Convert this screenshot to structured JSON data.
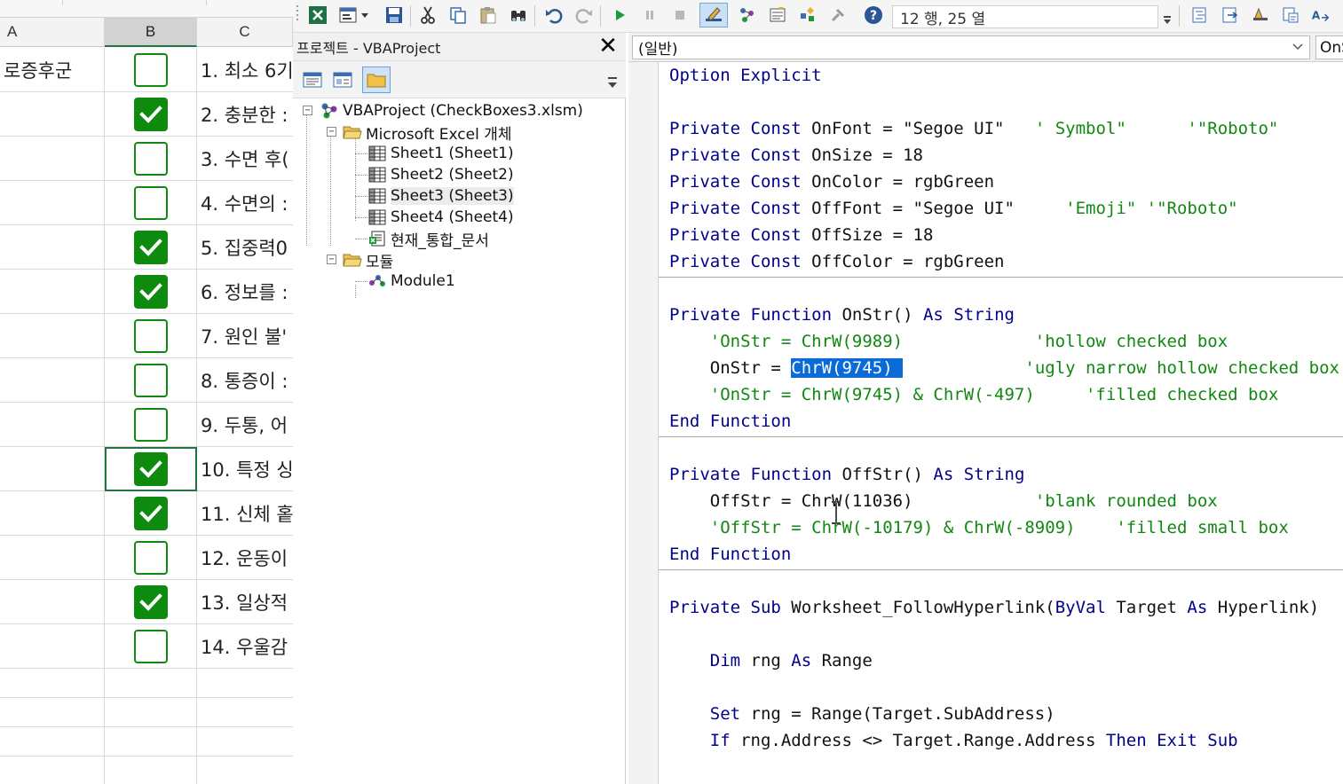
{
  "sheet": {
    "columns": [
      "A",
      "B",
      "C"
    ],
    "rows": [
      {
        "a": "로증후군",
        "checked": false,
        "c": "1. 최소 6기"
      },
      {
        "a": "",
        "checked": true,
        "c": "2. 충분한 :"
      },
      {
        "a": "",
        "checked": false,
        "c": "3. 수면 후("
      },
      {
        "a": "",
        "checked": false,
        "c": "4. 수면의 :"
      },
      {
        "a": "",
        "checked": true,
        "c": "5. 집중력0"
      },
      {
        "a": "",
        "checked": true,
        "c": "6. 정보를 :"
      },
      {
        "a": "",
        "checked": false,
        "c": "7. 원인 불'"
      },
      {
        "a": "",
        "checked": false,
        "c": "8. 통증이 :"
      },
      {
        "a": "",
        "checked": false,
        "c": "9. 두통, 어"
      },
      {
        "a": "",
        "checked": true,
        "c": "10. 특정 싱"
      },
      {
        "a": "",
        "checked": true,
        "c": "11. 신체 홑"
      },
      {
        "a": "",
        "checked": false,
        "c": "12. 운동이"
      },
      {
        "a": "",
        "checked": true,
        "c": "13. 일상적"
      },
      {
        "a": "",
        "checked": false,
        "c": "14. 우울감"
      }
    ]
  },
  "toolbar": {
    "position_status": "12 행, 25 열"
  },
  "project": {
    "title": "프로젝트 - VBAProject",
    "close_label": "✕",
    "root": "VBAProject (CheckBoxes3.xlsm)",
    "folder_objects": "Microsoft Excel 개체",
    "sheets": [
      "Sheet1 (Sheet1)",
      "Sheet2 (Sheet2)",
      "Sheet3 (Sheet3)",
      "Sheet4 (Sheet4)"
    ],
    "workbook": "현재_통합_문서",
    "folder_modules": "모듈",
    "module": "Module1"
  },
  "code": {
    "object_combo": "(일반)",
    "procedure_combo": "OnStr",
    "lines": {
      "l1": "Option Explicit",
      "c1_kw": "Private Const ",
      "c1_rest": "OnFont = \"Segoe UI\"   ",
      "c1_cm": "' Symbol\"      '\"Roboto\"",
      "c2_kw": "Private Const ",
      "c2_rest": "OnSize = 18",
      "c3_kw": "Private Const ",
      "c3_rest": "OnColor = rgbGreen",
      "c4_kw": "Private Const ",
      "c4_rest": "OffFont = \"Segoe UI\"     ",
      "c4_cm": "'Emoji\" '\"Roboto\"",
      "c5_kw": "Private Const ",
      "c5_rest": "OffSize = 18",
      "c6_kw": "Private Const ",
      "c6_rest": "OffColor = rgbGreen",
      "f1_kw": "Private Function ",
      "f1_name": "OnStr() ",
      "f1_as": "As ",
      "f1_type": "String",
      "f1_l1_cm": "    'OnStr = ChrW(9989)             'hollow checked box",
      "f1_l2_pre": "    OnStr = ",
      "f1_l2_hl": "ChrW(9745) ",
      "f1_l2_cm": "            'ugly narrow hollow checked box",
      "f1_l3_cm": "    'OnStr = ChrW(9745) & ChrW(-497)     'filled checked box",
      "f1_end": "End Function",
      "f2_kw": "Private Function ",
      "f2_name": "OffStr() ",
      "f2_as": "As ",
      "f2_type": "String",
      "f2_l1_pre": "    OffStr = ChrW(11036)            ",
      "f2_l1_cm": "'blank rounded box",
      "f2_l2_cm": "    'OffStr = ChrW(-10179) & ChrW(-8909)    'filled small box",
      "f2_end": "End Function",
      "s1_kw": "Private Sub ",
      "s1_name": "Worksheet_FollowHyperlink(",
      "s1_byval": "ByVal ",
      "s1_mid": "Target ",
      "s1_as": "As ",
      "s1_type": "Hyperlink)",
      "s1_l1_dim": "    Dim ",
      "s1_l1_mid": "rng ",
      "s1_l1_as": "As ",
      "s1_l1_type": "Range",
      "s1_l2_set": "    Set ",
      "s1_l2_rest": "rng = Range(Target.SubAddress)",
      "s1_l3_if": "    If ",
      "s1_l3_mid": "rng.Address <> Target.Range.Address ",
      "s1_l3_then": "Then Exit Sub"
    }
  },
  "colors": {
    "excel_green": "#217346",
    "check_green": "#0e8a0e",
    "keyword_blue": "#00008b",
    "comment_green": "#118811",
    "selection_blue": "#0a6bd8"
  }
}
